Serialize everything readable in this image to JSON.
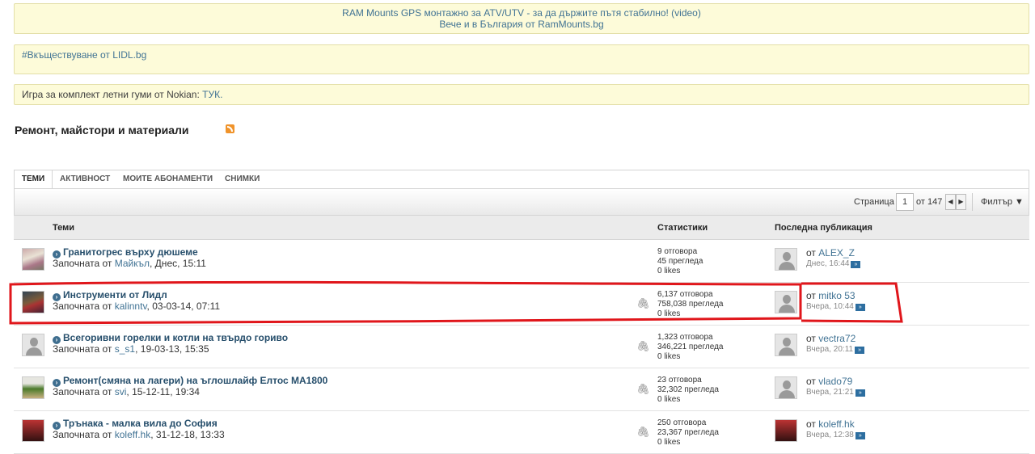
{
  "notices": {
    "n1_line1": "RAM Mounts GPS монтажно за ATV/UTV - за да държите пътя стабилно! (video)",
    "n1_line2": "Вече и в България от RamMounts.bg",
    "n2": "#Вкъществуване от LIDL.bg",
    "n3_text": "Игра за комплект летни гуми от Nokian: ",
    "n3_link": "ТУК."
  },
  "forum": {
    "title": "Ремонт, майстори и материали",
    "rss_icon": "rss-icon"
  },
  "tabs": [
    "ТЕМИ",
    "АКТИВНОСТ",
    "МОИТЕ АБОНАМЕНТИ",
    "СНИМКИ"
  ],
  "toolbar": {
    "page_label": "Страница",
    "page_value": "1",
    "page_of": "от 147",
    "prev": "◀",
    "next": "▶",
    "filter": "Филтър ▼"
  },
  "columns": {
    "topics": "Теми",
    "stats": "Статистики",
    "last_post": "Последна публикация"
  },
  "threads": [
    {
      "title": "Гранитогрес върху дюшеме",
      "started_by_label": "Започната от",
      "author": "Майкъл",
      "date": ", Днес, 15:11",
      "replies": "9 отговора",
      "views": "45 прегледа",
      "likes": "0 likes",
      "last_by_label": "от",
      "last_user": "ALEX_Z",
      "last_date": "Днес, 16:44"
    },
    {
      "title": "Инструменти от Лидл",
      "started_by_label": "Започната от",
      "author": "kalinntv",
      "date": ", 03-03-14, 07:11",
      "replies": "6,137 отговора",
      "views": "758,038 прегледа",
      "likes": "0 likes",
      "last_by_label": "от",
      "last_user": "mitko 53",
      "last_date": "Вчера, 10:44"
    },
    {
      "title": "Всегоривни горелки и котли на твърдо гориво",
      "started_by_label": "Започната от",
      "author": "s_s1",
      "date": ", 19-03-13, 15:35",
      "replies": "1,323 отговора",
      "views": "346,221 прегледа",
      "likes": "0 likes",
      "last_by_label": "от",
      "last_user": "vectra72",
      "last_date": "Вчера, 20:11"
    },
    {
      "title": "Ремонт(смяна на лагери) на ъглошлайф Елтос МА1800",
      "started_by_label": "Започната от",
      "author": "svi",
      "date": ", 15-12-11, 19:34",
      "replies": "23 отговора",
      "views": "32,302 прегледа",
      "likes": "0 likes",
      "last_by_label": "от",
      "last_user": "vlado79",
      "last_date": "Вчера, 21:21"
    },
    {
      "title": "Трънака - малка вила до София",
      "started_by_label": "Започната от",
      "author": "koleff.hk",
      "date": ", 31-12-18, 13:33",
      "replies": "250 отговора",
      "views": "23,367 прегледа",
      "likes": "0 likes",
      "last_by_label": "от",
      "last_user": "koleff.hk",
      "last_date": "Вчера, 12:38"
    }
  ],
  "colors": {
    "link": "#417394",
    "title": "#274f6c",
    "notice_bg": "#fdfbd9",
    "highlight_red": "#e0161b"
  }
}
